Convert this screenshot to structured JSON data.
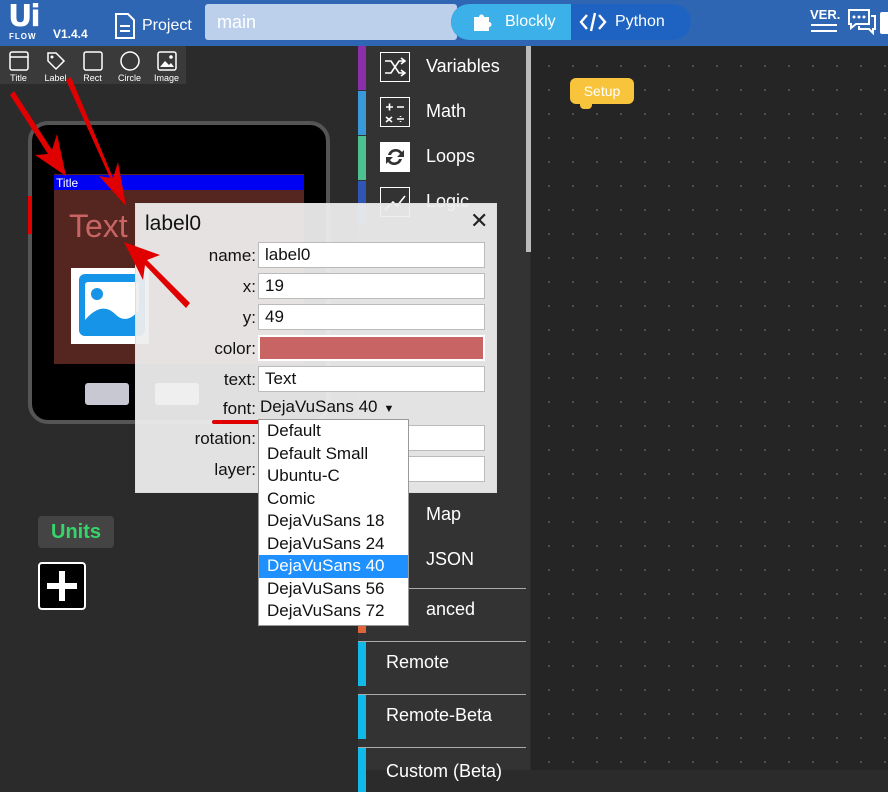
{
  "app": {
    "logo_top": "Ui",
    "logo_bottom": "FLOW",
    "version": "V1.4.4",
    "project_label": "Project",
    "file_name": "main"
  },
  "mode": {
    "blockly": "Blockly",
    "python": "Python"
  },
  "header_icons": {
    "ver": "VER."
  },
  "toolbox": [
    {
      "label": "Title",
      "icon": "title-icon"
    },
    {
      "label": "Label",
      "icon": "tag-icon"
    },
    {
      "label": "Rect",
      "icon": "rect-icon"
    },
    {
      "label": "Circle",
      "icon": "circle-icon"
    },
    {
      "label": "Image",
      "icon": "image-icon"
    }
  ],
  "device": {
    "title": "Title",
    "text": "Text"
  },
  "units": {
    "label": "Units"
  },
  "categories": [
    {
      "label": "Variables",
      "color": "#8b2fa8"
    },
    {
      "label": "Math",
      "color": "#3a9ad9"
    },
    {
      "label": "Loops",
      "color": "#4cc08f"
    },
    {
      "label": "Logic",
      "color": "#2f55b6"
    },
    {
      "label": "Map",
      "color": "#777777"
    },
    {
      "label": "JSON",
      "color": "#777777"
    },
    {
      "label": "anced",
      "color": "#e0633a"
    },
    {
      "label": "Remote",
      "color": "#12b8e8"
    },
    {
      "label": "Remote-Beta",
      "color": "#12b8e8"
    },
    {
      "label": "Custom (Beta)",
      "color": "#12b8e8"
    }
  ],
  "workspace": {
    "setup_block": "Setup"
  },
  "props": {
    "title": "label0",
    "close": "✕",
    "name_label": "name:",
    "name_value": "label0",
    "x_label": "x:",
    "x_value": "19",
    "y_label": "y:",
    "y_value": "49",
    "color_label": "color:",
    "color_value": "#c86464",
    "text_label": "text:",
    "text_value": "Text",
    "font_label": "font:",
    "font_value": "DejaVuSans 40",
    "rotation_label": "rotation:",
    "layer_label": "layer:"
  },
  "font_options": [
    "Default",
    "Default Small",
    "Ubuntu-C",
    "Comic",
    "DejaVuSans 18",
    "DejaVuSans 24",
    "DejaVuSans 40",
    "DejaVuSans 56",
    "DejaVuSans 72"
  ],
  "font_selected_index": 6,
  "colors": {
    "header": "#2f66b4",
    "accent": "#3cb0e8",
    "selected": "#1e90ff",
    "units": "#35d56a",
    "setup": "#f8c43c"
  }
}
